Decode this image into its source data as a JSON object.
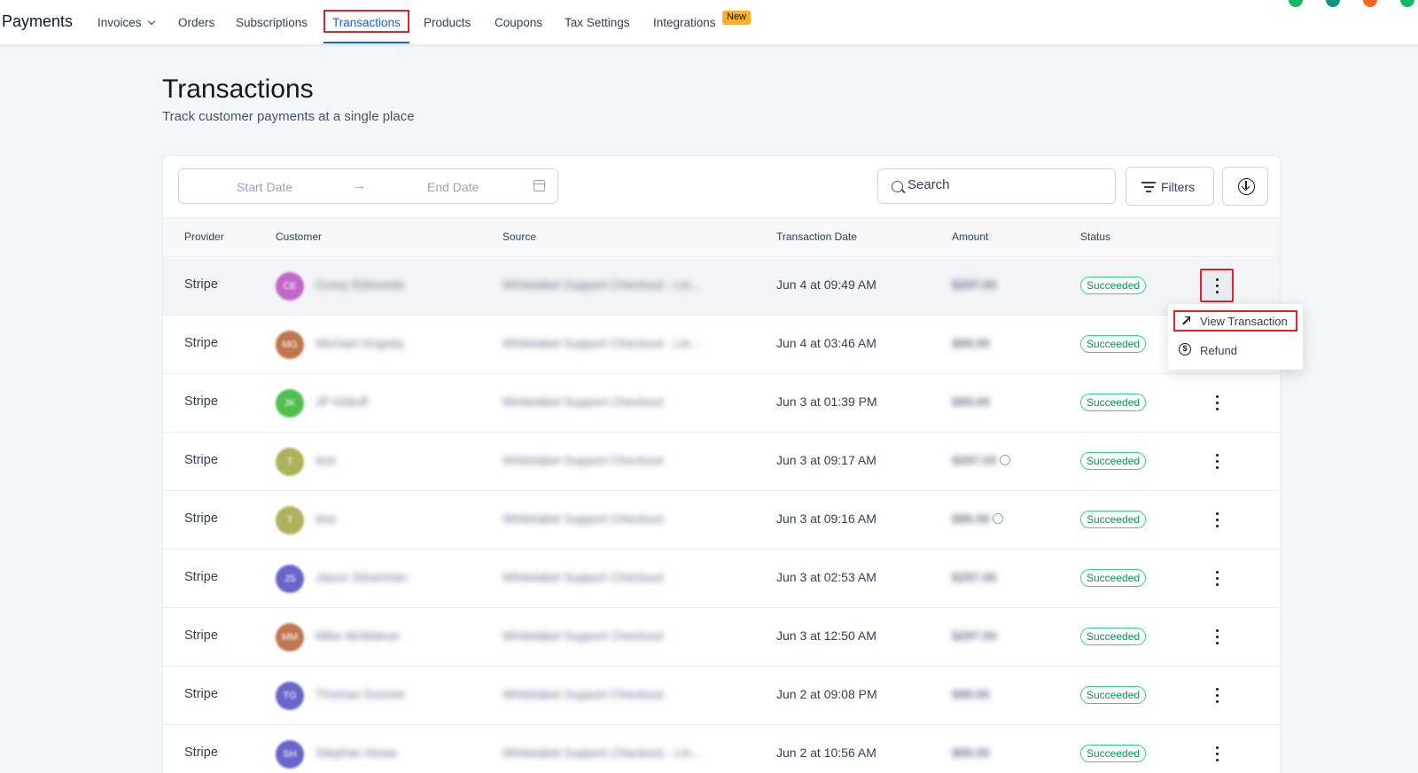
{
  "app": {
    "title": "Payments"
  },
  "nav": {
    "items": [
      {
        "label": "Invoices",
        "has_dropdown": true
      },
      {
        "label": "Orders"
      },
      {
        "label": "Subscriptions"
      },
      {
        "label": "Transactions",
        "active": true
      },
      {
        "label": "Products"
      },
      {
        "label": "Coupons"
      },
      {
        "label": "Tax Settings"
      },
      {
        "label": "Integrations",
        "badge": "New"
      }
    ],
    "status_dot_colors": [
      "#12b76a",
      "#0e9384",
      "#ef6820",
      "#12b76a"
    ]
  },
  "page": {
    "title": "Transactions",
    "subtitle": "Track customer payments at a single place"
  },
  "toolbar": {
    "start_date_placeholder": "Start Date",
    "arrow": "→",
    "end_date_placeholder": "End Date",
    "search_placeholder": "Search",
    "filters_label": "Filters",
    "download_icon": "download-circle-icon"
  },
  "table": {
    "columns": [
      "Provider",
      "Customer",
      "Source",
      "Transaction Date",
      "Amount",
      "Status"
    ],
    "rows": [
      {
        "provider": "Stripe",
        "avatar_initials": "CE",
        "avatar_color": "#c266c9",
        "customer": "Corey Edmonds",
        "source": "Whitelabel Support Checkout - Lin...",
        "date": "Jun 4 at 09:49 AM",
        "amount": "$297.00",
        "info": false,
        "status": "Succeeded"
      },
      {
        "provider": "Stripe",
        "avatar_initials": "MG",
        "avatar_color": "#c0764f",
        "customer": "Michael Grigsby",
        "source": "Whitelabel Support Checkout - Lin...",
        "date": "Jun 4 at 03:46 AM",
        "amount": "$99.00",
        "info": false,
        "status": "Succeeded"
      },
      {
        "provider": "Stripe",
        "avatar_initials": "JK",
        "avatar_color": "#4fbf4f",
        "customer": "JP Kilduff",
        "source": "Whitelabel Support Checkout",
        "date": "Jun 3 at 01:39 PM",
        "amount": "$99.00",
        "info": false,
        "status": "Succeeded"
      },
      {
        "provider": "Stripe",
        "avatar_initials": "T",
        "avatar_color": "#aeb25a",
        "customer": "test",
        "source": "Whitelabel Support Checkout",
        "date": "Jun 3 at 09:17 AM",
        "amount": "$297.00",
        "info": true,
        "status": "Succeeded"
      },
      {
        "provider": "Stripe",
        "avatar_initials": "T",
        "avatar_color": "#aeb25a",
        "customer": "test",
        "source": "Whitelabel Support Checkout",
        "date": "Jun 3 at 09:16 AM",
        "amount": "$99.00",
        "info": true,
        "status": "Succeeded"
      },
      {
        "provider": "Stripe",
        "avatar_initials": "JS",
        "avatar_color": "#6a66c9",
        "customer": "Jason Silverman",
        "source": "Whitelabel Support Checkout",
        "date": "Jun 3 at 02:53 AM",
        "amount": "$297.00",
        "info": false,
        "status": "Succeeded"
      },
      {
        "provider": "Stripe",
        "avatar_initials": "MM",
        "avatar_color": "#c0764f",
        "customer": "Mike McMahon",
        "source": "Whitelabel Support Checkout",
        "date": "Jun 3 at 12:50 AM",
        "amount": "$297.00",
        "info": false,
        "status": "Succeeded"
      },
      {
        "provider": "Stripe",
        "avatar_initials": "TG",
        "avatar_color": "#6a66c9",
        "customer": "Thomas Gonnet",
        "source": "Whitelabel Support Checkout",
        "date": "Jun 2 at 09:08 PM",
        "amount": "$99.00",
        "info": false,
        "status": "Succeeded"
      },
      {
        "provider": "Stripe",
        "avatar_initials": "SH",
        "avatar_color": "#6a66c9",
        "customer": "Stephan Howe",
        "source": "Whitelabel Support Checkout - Lin...",
        "date": "Jun 2 at 10:56 AM",
        "amount": "$99.00",
        "info": false,
        "status": "Succeeded"
      }
    ]
  },
  "row_menu": {
    "items": [
      {
        "label": "View Transaction",
        "icon": "arrow-up-right-icon"
      },
      {
        "label": "Refund",
        "icon": "dollar-circle-icon"
      }
    ]
  }
}
